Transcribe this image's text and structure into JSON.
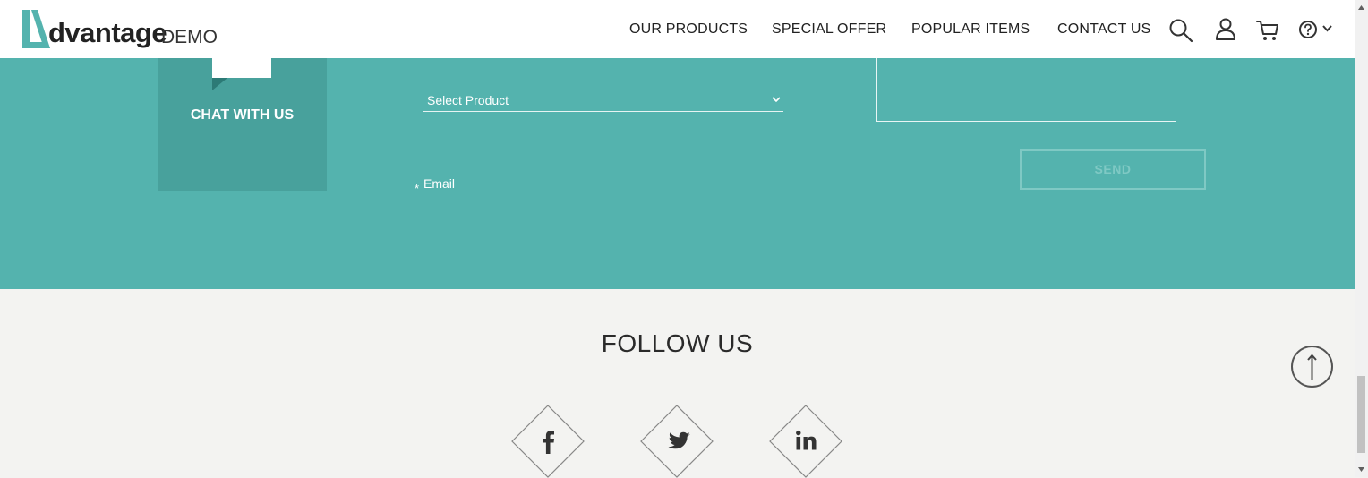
{
  "header": {
    "logo": {
      "word": "dvantage",
      "demo": "DEMO"
    },
    "nav": [
      {
        "label": "OUR PRODUCTS"
      },
      {
        "label": "SPECIAL OFFER"
      },
      {
        "label": "POPULAR ITEMS"
      },
      {
        "label": "CONTACT US"
      }
    ],
    "icons": [
      "search-icon",
      "user-icon",
      "cart-icon",
      "help-icon",
      "chevron-down-icon"
    ]
  },
  "contact": {
    "chat_label": "CHAT WITH US",
    "select_value": "Select Product",
    "email_required_mark": "*",
    "email_placeholder": "Email",
    "send_label": "SEND"
  },
  "follow": {
    "title": "FOLLOW US",
    "social": [
      "facebook-icon",
      "twitter-icon",
      "linkedin-icon"
    ]
  },
  "colors": {
    "teal": "#54b3ae",
    "teal_dark": "#48a19c",
    "footer_bg": "#f3f3f1"
  }
}
